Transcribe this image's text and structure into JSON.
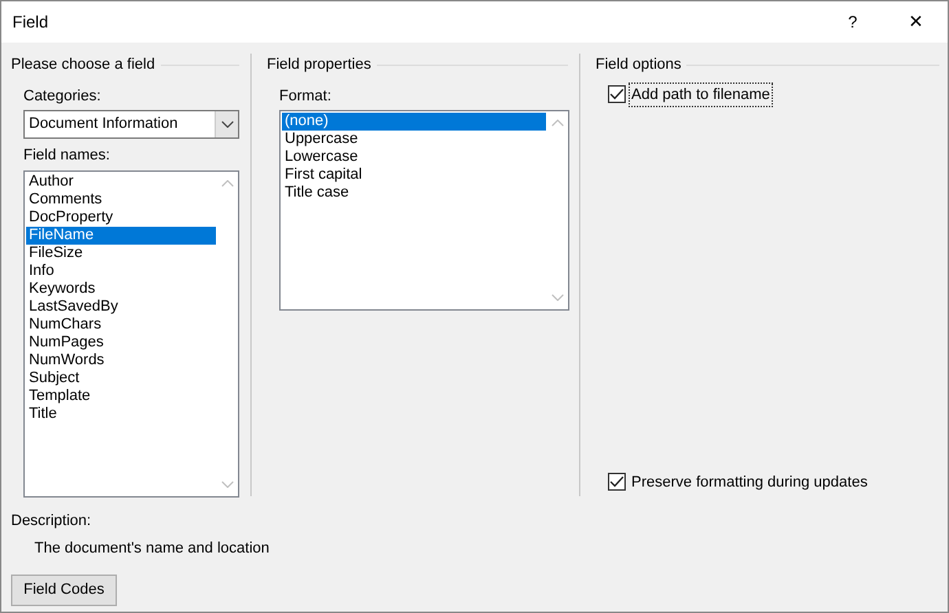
{
  "window": {
    "title": "Field",
    "help": "?",
    "close": "✕"
  },
  "choose_field": {
    "heading": "Please choose a field",
    "categories_label": "Categories:",
    "category": "Document Information",
    "field_names_label": "Field names:",
    "field_names": [
      {
        "label": "Author",
        "selected": false
      },
      {
        "label": "Comments",
        "selected": false
      },
      {
        "label": "DocProperty",
        "selected": false
      },
      {
        "label": "FileName",
        "selected": true
      },
      {
        "label": "FileSize",
        "selected": false
      },
      {
        "label": "Info",
        "selected": false
      },
      {
        "label": "Keywords",
        "selected": false
      },
      {
        "label": "LastSavedBy",
        "selected": false
      },
      {
        "label": "NumChars",
        "selected": false
      },
      {
        "label": "NumPages",
        "selected": false
      },
      {
        "label": "NumWords",
        "selected": false
      },
      {
        "label": "Subject",
        "selected": false
      },
      {
        "label": "Template",
        "selected": false
      },
      {
        "label": "Title",
        "selected": false
      }
    ]
  },
  "field_properties": {
    "heading": "Field properties",
    "format_label": "Format:",
    "formats": [
      {
        "label": "(none)",
        "selected": true
      },
      {
        "label": "Uppercase",
        "selected": false
      },
      {
        "label": "Lowercase",
        "selected": false
      },
      {
        "label": "First capital",
        "selected": false
      },
      {
        "label": "Title case",
        "selected": false
      }
    ]
  },
  "field_options": {
    "heading": "Field options",
    "add_path": {
      "label": "Add path to filename",
      "checked": true
    },
    "preserve": {
      "label": "Preserve formatting during updates",
      "checked": true
    }
  },
  "description": {
    "label": "Description:",
    "text": "The document's name and location"
  },
  "buttons": {
    "field_codes": "Field Codes"
  }
}
